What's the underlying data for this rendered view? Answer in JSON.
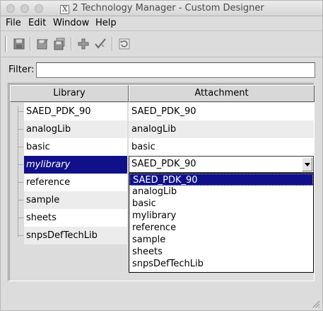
{
  "window": {
    "title": "2 Technology Manager - Custom Designer",
    "x_logo": "X"
  },
  "menu": {
    "items": [
      "File",
      "Edit",
      "Window",
      "Help"
    ]
  },
  "toolbar": {
    "buttons": [
      "save-icon",
      "save-as-icon",
      "save-all-icon",
      "add-icon",
      "check-icon",
      "refresh-icon"
    ]
  },
  "filter": {
    "label": "Filter:",
    "value": ""
  },
  "table": {
    "headers": {
      "library": "Library",
      "attachment": "Attachment"
    },
    "rows": [
      {
        "library": "SAED_PDK_90",
        "attachment": "SAED_PDK_90",
        "selected": false
      },
      {
        "library": "analogLib",
        "attachment": "analogLib",
        "selected": false
      },
      {
        "library": "basic",
        "attachment": "basic",
        "selected": false
      },
      {
        "library": "mylibrary",
        "attachment": "SAED_PDK_90",
        "selected": true
      },
      {
        "library": "reference",
        "attachment": "",
        "selected": false
      },
      {
        "library": "sample",
        "attachment": "",
        "selected": false
      },
      {
        "library": "sheets",
        "attachment": "",
        "selected": false
      },
      {
        "library": "snpsDefTechLib",
        "attachment": "",
        "selected": false
      }
    ]
  },
  "dropdown": {
    "value": "SAED_PDK_90",
    "options": [
      "SAED_PDK_90",
      "analogLib",
      "basic",
      "mylibrary",
      "reference",
      "sample",
      "sheets",
      "snpsDefTechLib"
    ],
    "highlighted": "SAED_PDK_90"
  },
  "colors": {
    "selection": "#10108a",
    "chrome": "#dcdcdc"
  }
}
